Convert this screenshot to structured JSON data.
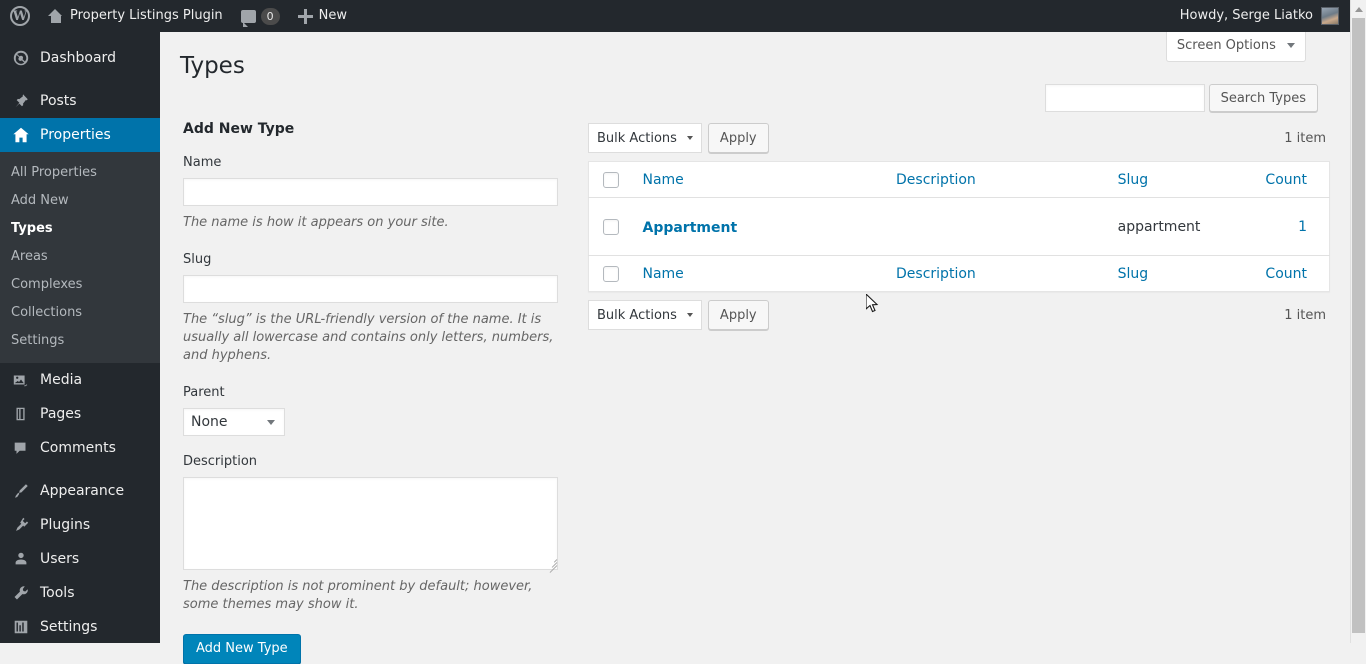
{
  "adminbar": {
    "logo_icon": "wordpress-logo-icon",
    "home_icon": "home-icon",
    "site_title": "Property Listings Plugin",
    "comments_icon": "comment-bubble-icon",
    "comments_count": "0",
    "new_icon": "plus-icon",
    "new_label": "New",
    "howdy": "Howdy, Serge Liatko",
    "avatar_icon": "user-avatar"
  },
  "sidebar": {
    "items": [
      {
        "label": "Dashboard",
        "icon": "dashboard-icon",
        "current": false
      },
      {
        "label": "Posts",
        "icon": "pin-icon",
        "current": false
      },
      {
        "label": "Properties",
        "icon": "home-icon",
        "current": true
      },
      {
        "label": "Media",
        "icon": "media-icon",
        "current": false
      },
      {
        "label": "Pages",
        "icon": "pages-icon",
        "current": false
      },
      {
        "label": "Comments",
        "icon": "comment-icon",
        "current": false
      },
      {
        "label": "Appearance",
        "icon": "brush-icon",
        "current": false
      },
      {
        "label": "Plugins",
        "icon": "plug-icon",
        "current": false
      },
      {
        "label": "Users",
        "icon": "user-icon",
        "current": false
      },
      {
        "label": "Tools",
        "icon": "wrench-icon",
        "current": false
      },
      {
        "label": "Settings",
        "icon": "sliders-icon",
        "current": false
      }
    ],
    "submenu": [
      {
        "label": "All Properties",
        "current": false
      },
      {
        "label": "Add New",
        "current": false
      },
      {
        "label": "Types",
        "current": true
      },
      {
        "label": "Areas",
        "current": false
      },
      {
        "label": "Complexes",
        "current": false
      },
      {
        "label": "Collections",
        "current": false
      },
      {
        "label": "Settings",
        "current": false
      }
    ]
  },
  "screen_options": {
    "label": "Screen Options",
    "caret_icon": "chevron-down-icon"
  },
  "page": {
    "title": "Types"
  },
  "search": {
    "value": "",
    "placeholder": "",
    "button_label": "Search Types"
  },
  "form": {
    "heading": "Add New Type",
    "name_label": "Name",
    "name_value": "",
    "name_help": "The name is how it appears on your site.",
    "slug_label": "Slug",
    "slug_value": "",
    "slug_help": "The “slug” is the URL-friendly version of the name. It is usually all lowercase and contains only letters, numbers, and hyphens.",
    "parent_label": "Parent",
    "parent_value": "None",
    "parent_options": [
      "None"
    ],
    "description_label": "Description",
    "description_value": "",
    "description_help": "The description is not prominent by default; however, some themes may show it.",
    "submit_label": "Add New Type"
  },
  "table": {
    "bulk_actions_label": "Bulk Actions",
    "bulk_actions_options": [
      "Bulk Actions"
    ],
    "apply_label": "Apply",
    "item_count": "1 item",
    "columns": [
      "Name",
      "Description",
      "Slug",
      "Count"
    ],
    "rows": [
      {
        "name": "Appartment",
        "description": "",
        "slug": "appartment",
        "count": "1"
      }
    ]
  },
  "colors": {
    "admin_dark": "#23282d",
    "submenu_bg": "#32373c",
    "accent_blue": "#0073aa",
    "link_blue": "#0073aa",
    "button_blue": "#0085ba",
    "content_bg": "#f1f1f1"
  },
  "cursor": {
    "icon": "mouse-pointer-icon"
  }
}
